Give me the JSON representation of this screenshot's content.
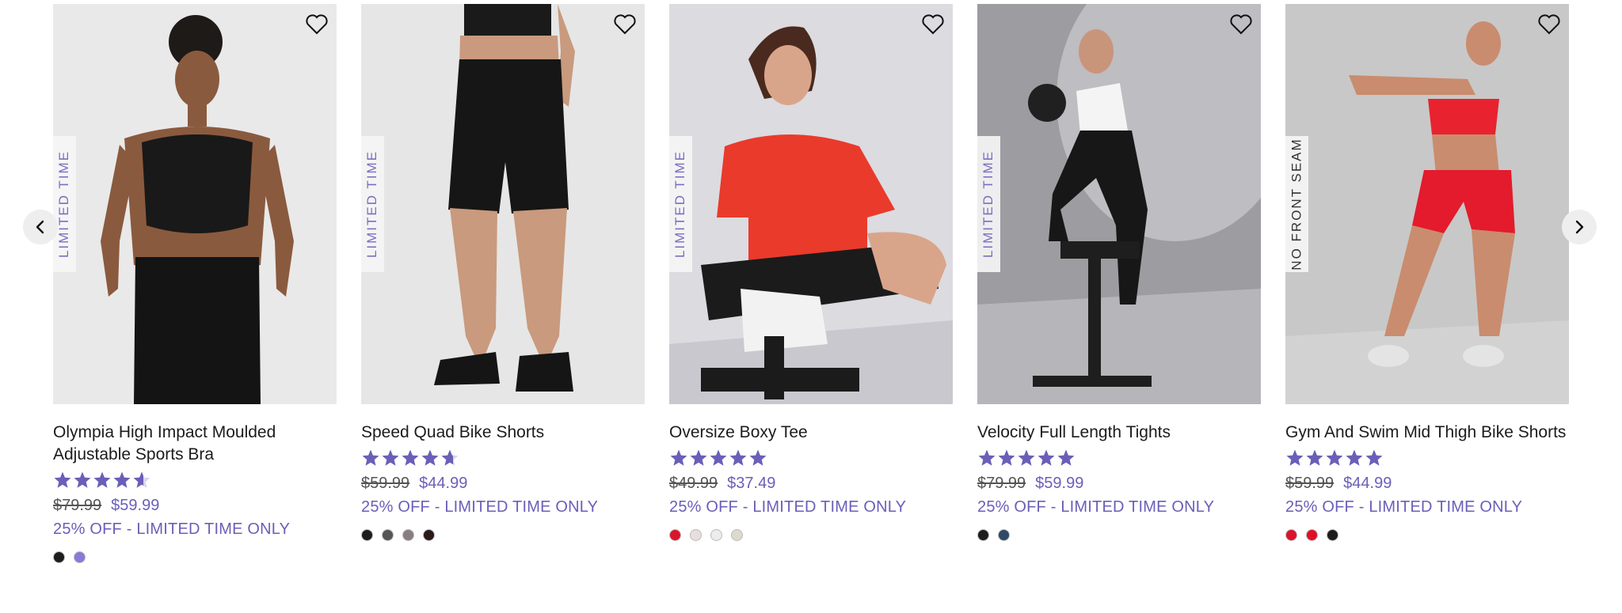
{
  "nav": {
    "prev_icon": "chevron-left-icon",
    "next_icon": "chevron-right-icon"
  },
  "colors": {
    "accent": "#6a5fb8",
    "star": "#6a5fb8"
  },
  "products": [
    {
      "title": "Olympia High Impact Moulded Adjustable Sports Bra",
      "badge": "LIMITED TIME",
      "rating": 4.6,
      "old_price": "$79.99",
      "new_price": "$59.99",
      "promo": "25% OFF - LIMITED TIME ONLY",
      "swatches": [
        "#1d1d1d",
        "#8b78d8"
      ]
    },
    {
      "title": "Speed Quad Bike Shorts",
      "badge": "LIMITED TIME",
      "rating": 4.7,
      "old_price": "$59.99",
      "new_price": "$44.99",
      "promo": "25% OFF - LIMITED TIME ONLY",
      "swatches": [
        "#1d1d1d",
        "#555555",
        "#8a7d80",
        "#2b1a18"
      ]
    },
    {
      "title": "Oversize Boxy Tee",
      "badge": "LIMITED TIME",
      "rating": 5,
      "old_price": "$49.99",
      "new_price": "$37.49",
      "promo": "25% OFF - LIMITED TIME ONLY",
      "swatches": [
        "#d9142b",
        "#e8dede",
        "#ececec",
        "#ddd9cf"
      ]
    },
    {
      "title": "Velocity Full Length Tights",
      "badge": "LIMITED TIME",
      "rating": 5,
      "old_price": "$79.99",
      "new_price": "$59.99",
      "promo": "25% OFF - LIMITED TIME ONLY",
      "swatches": [
        "#1d1d1d",
        "#2f4866"
      ]
    },
    {
      "title": "Gym And Swim Mid Thigh Bike Shorts",
      "badge": "NO FRONT SEAM",
      "rating": 5,
      "old_price": "$59.99",
      "new_price": "$44.99",
      "promo": "25% OFF - LIMITED TIME ONLY",
      "swatches": [
        "#d9142b",
        "#e01024",
        "#1d1d1d"
      ]
    }
  ]
}
